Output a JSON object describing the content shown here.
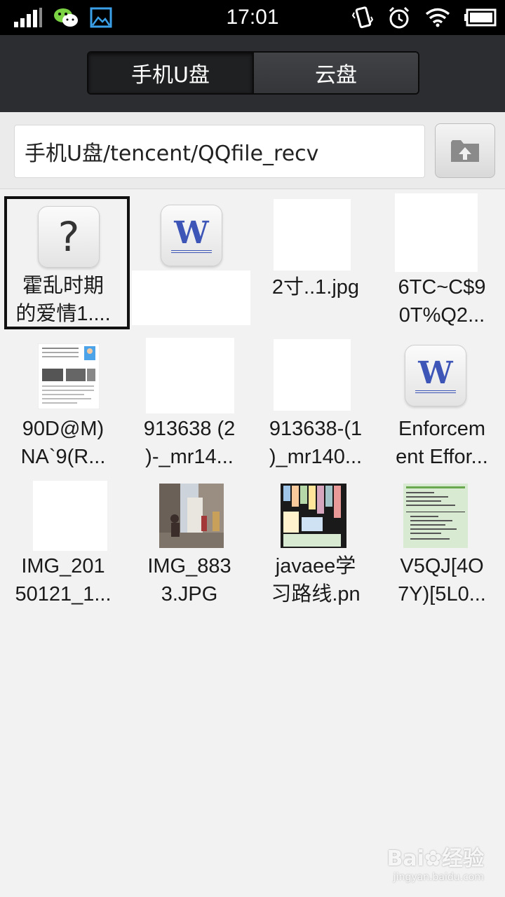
{
  "status_bar": {
    "time": "17:01",
    "left_icons": [
      "signal-icon",
      "wechat-icon",
      "gallery-icon"
    ],
    "right_icons": [
      "vibrate-icon",
      "alarm-icon",
      "wifi-icon",
      "battery-icon"
    ]
  },
  "tabs": [
    {
      "label": "手机U盘",
      "active": true
    },
    {
      "label": "云盘",
      "active": false
    }
  ],
  "path": {
    "value": "手机U盘/tencent/QQfile_recv",
    "up_button_icon": "folder-up-icon"
  },
  "files": [
    {
      "name_line1": "霍乱时期",
      "name_line2": "的爱情1....",
      "type": "unknown",
      "selected": true
    },
    {
      "name_line1": "",
      "name_line2": "",
      "type": "word"
    },
    {
      "name_line1": "2寸..1.jpg",
      "name_line2": "",
      "type": "image-blank"
    },
    {
      "name_line1": "6TC~C$9",
      "name_line2": "0T%Q2...",
      "type": "image-blank"
    },
    {
      "name_line1": "90D@M)",
      "name_line2": "NA`9(R...",
      "type": "image-doc"
    },
    {
      "name_line1": "913638 (2",
      "name_line2": ")-_mr14...",
      "type": "image-blank"
    },
    {
      "name_line1": "913638-(1",
      "name_line2": ")_mr140...",
      "type": "image-blank"
    },
    {
      "name_line1": "Enforcem",
      "name_line2": "ent Effor...",
      "type": "word"
    },
    {
      "name_line1": "IMG_201",
      "name_line2": "50121_1...",
      "type": "image-blank"
    },
    {
      "name_line1": "IMG_883",
      "name_line2": "3.JPG",
      "type": "image-photo"
    },
    {
      "name_line1": "javaee学",
      "name_line2": "习路线.pn",
      "type": "image-chart"
    },
    {
      "name_line1": "V5QJ[4O",
      "name_line2": "7Y)[5L0...",
      "type": "image-green"
    }
  ],
  "watermark": {
    "brand": "Bai",
    "brand2": "经验",
    "url": "jingyan.baidu.com"
  },
  "colors": {
    "header_bg": "#2b2d30",
    "word_blue": "#3c55b7",
    "background": "#f2f2f2"
  }
}
